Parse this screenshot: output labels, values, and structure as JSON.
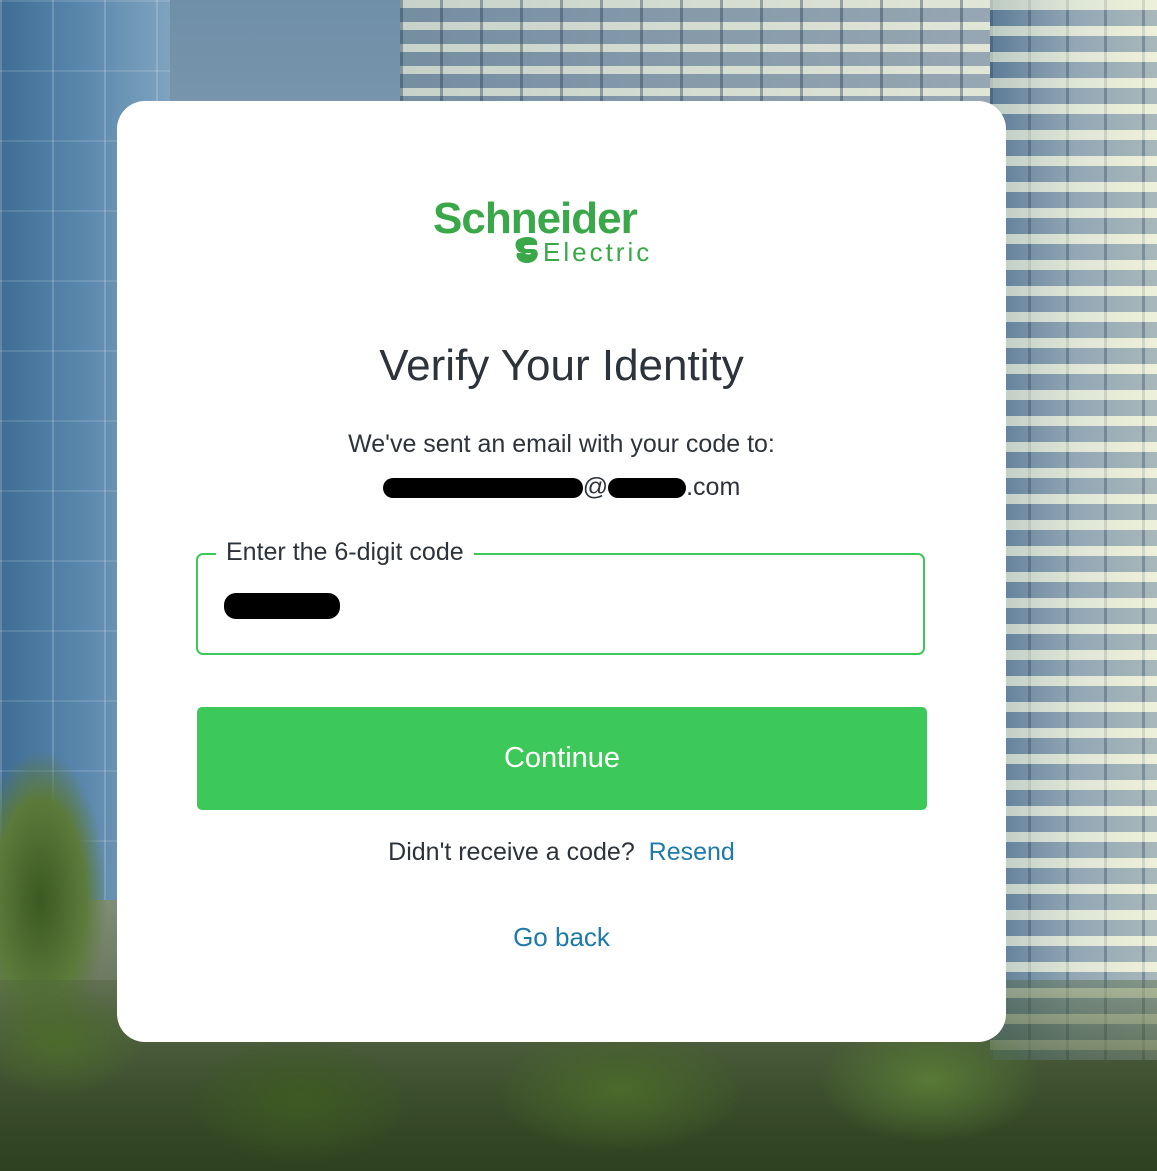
{
  "brand": {
    "name": "Schneider",
    "sub": "Electric",
    "color": "#3aa849"
  },
  "page": {
    "title": "Verify Your Identity",
    "description": "We've sent an email with your code to:",
    "email_domain_suffix": ".com",
    "email_at": "@"
  },
  "code_field": {
    "label": "Enter the 6-digit code"
  },
  "actions": {
    "continue_label": "Continue",
    "resend_prompt": "Didn't receive a code?",
    "resend_label": "Resend",
    "go_back_label": "Go back"
  },
  "colors": {
    "accent": "#3dc85a",
    "link": "#1e7aa8",
    "text": "#2d333a"
  }
}
